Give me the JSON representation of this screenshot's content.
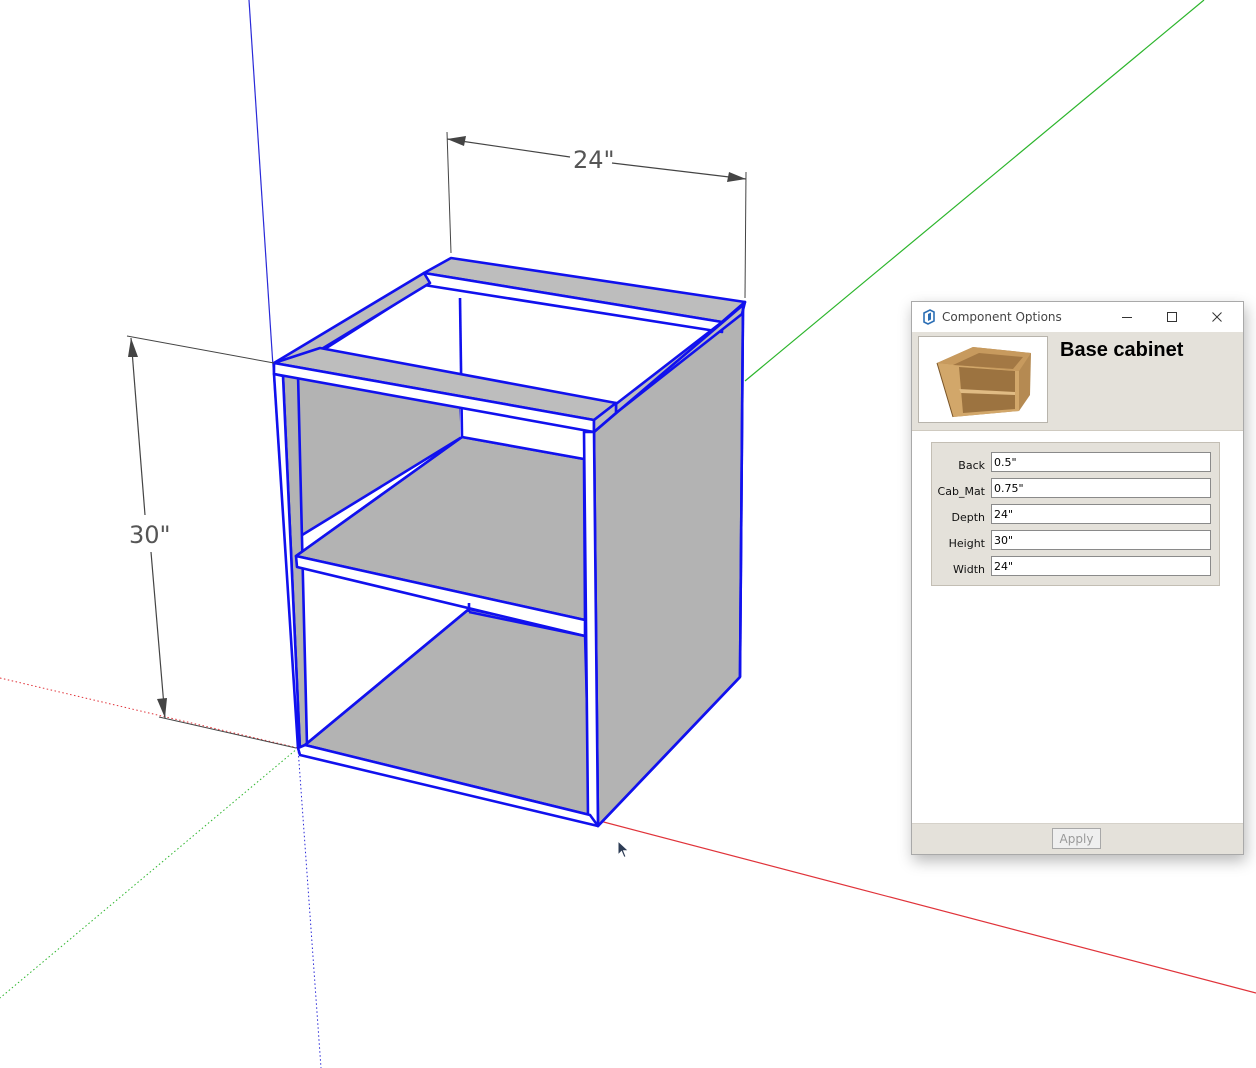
{
  "viewport": {
    "width_dimension": "24\"",
    "height_dimension": "30\"",
    "axis_colors": {
      "red": "#e0333a",
      "green": "#2cb52c",
      "blue": "#2a2ad8"
    },
    "selection_color": "#1111ee",
    "face_color": "#b3b3b3"
  },
  "dialog": {
    "title": "Component Options",
    "icon": "sketchup-logo-icon",
    "controls": [
      "minimize-icon",
      "maximize-icon",
      "close-icon"
    ],
    "component_name": "Base cabinet",
    "attributes": [
      {
        "label": "Back",
        "value": "0.5\""
      },
      {
        "label": "Cab_Mat",
        "value": "0.75\""
      },
      {
        "label": "Depth",
        "value": "24\""
      },
      {
        "label": "Height",
        "value": "30\""
      },
      {
        "label": "Width",
        "value": "24\""
      }
    ],
    "apply_label": "Apply"
  }
}
